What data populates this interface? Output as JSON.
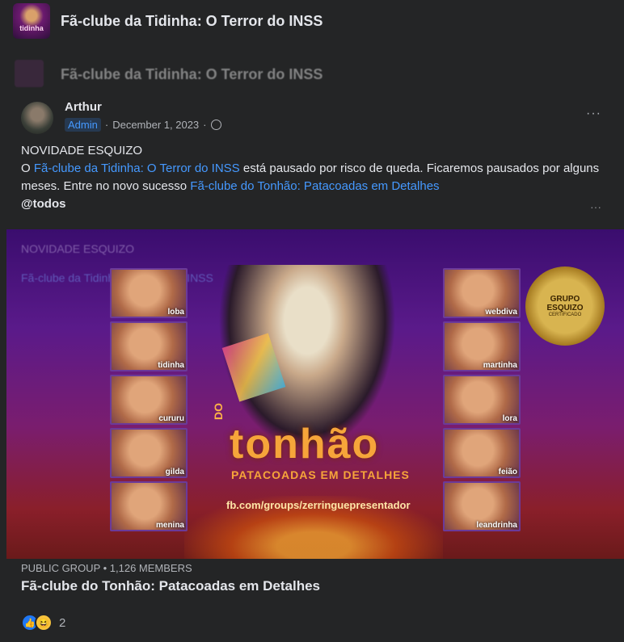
{
  "group": {
    "avatar_label": "tidinha",
    "title": "Fã-clube da Tidinha: O Terror do INSS"
  },
  "post": {
    "author": "Arthur",
    "badge": "Admin",
    "date": "December 1, 2023",
    "headline": "NOVIDADE ESQUIZO",
    "text_prefix": "O ",
    "link_old_group": "Fã-clube da Tidinha: O Terror do INSS",
    "text_middle": " está pausado por risco de queda. Ficaremos pausados por alguns meses. Entre no novo sucesso ",
    "link_new_group": "Fã-clube do Tonhão: Patacoadas em Detalhes",
    "mention": "@todos"
  },
  "banner": {
    "left_faces": [
      "loba",
      "tidinha",
      "cururu",
      "gilda",
      "menina"
    ],
    "right_faces": [
      "webdiva",
      "martinha",
      "lora",
      "feião",
      "leandrinha"
    ],
    "do_text": "DO",
    "title": "tonhão",
    "subtitle": "PATACOADAS EM DETALHES",
    "url": "fb.com/groups/zerringuepresentador",
    "seal_line1": "GRUPO",
    "seal_line2": "ESQUIZO",
    "seal_line3": "CERTIFICADO"
  },
  "link_preview": {
    "kicker": "PUBLIC GROUP • 1,126 MEMBERS",
    "title": "Fã-clube do Tonhão: Patacoadas em Detalhes"
  },
  "reactions": {
    "count": "2",
    "icons": [
      "like-icon",
      "haha-icon"
    ]
  },
  "colors": {
    "background": "#242526",
    "link": "#4599ff",
    "accent_orange": "#f6a53a"
  }
}
